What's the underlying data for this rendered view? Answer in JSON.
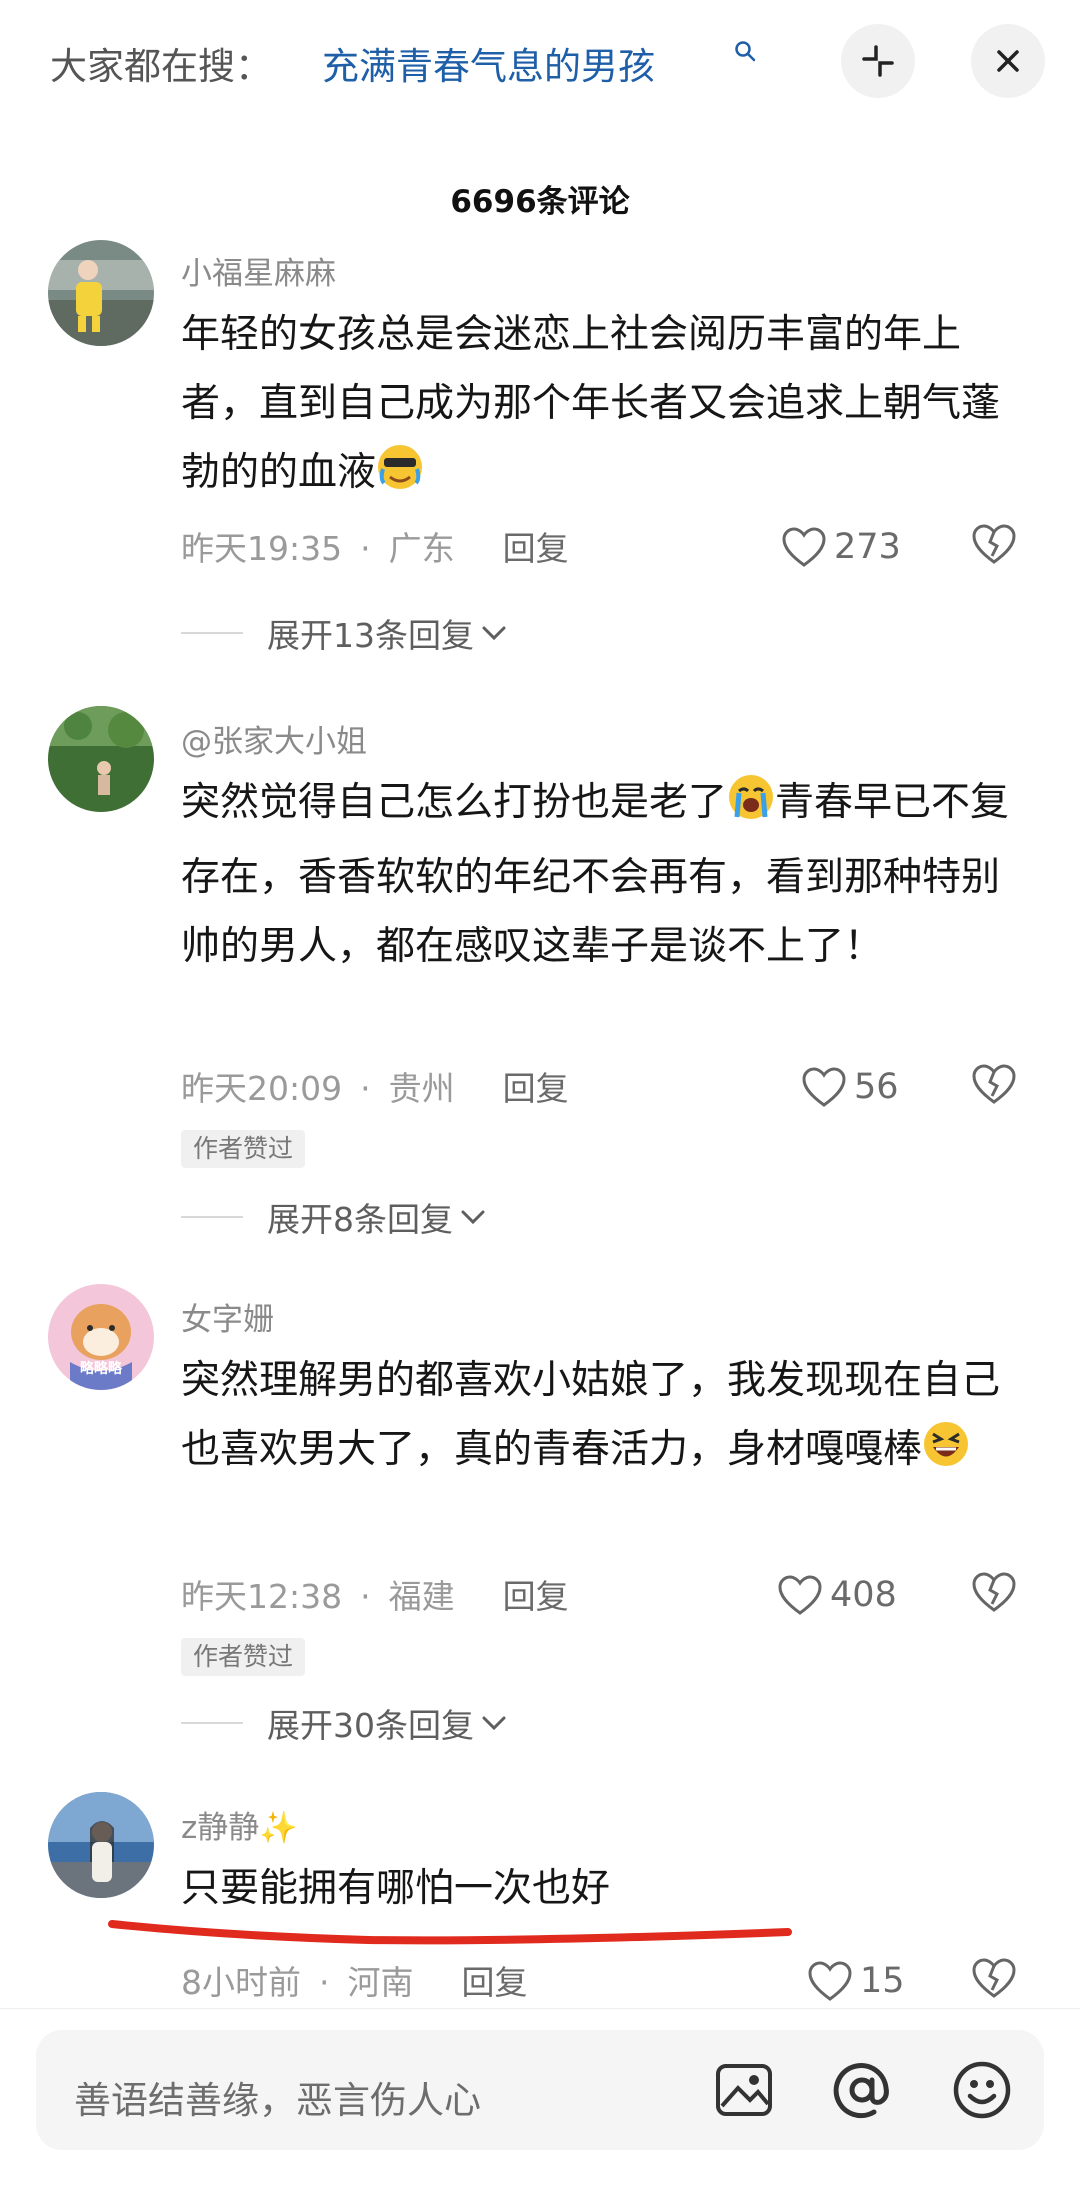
{
  "search_bar": {
    "prefix": "大家都在搜：",
    "term": "充满青春气息的男孩"
  },
  "comments_header": {
    "count_label": "6696条评论"
  },
  "comments": [
    {
      "username": "小福星麻麻",
      "text": "年轻的女孩总是会迷恋上社会阅历丰富的年上者，直到自己成为那个年长者又会追求上朝气蓬勃的的血液",
      "emoji": "crying-sunglasses-face-icon",
      "time": "昨天19:35",
      "location": "广东",
      "reply_label": "回复",
      "likes": "273",
      "badge": "",
      "expand_label": "展开13条回复"
    },
    {
      "username": "@张家大小姐",
      "text_part1": "突然觉得自己怎么打扮也是老了",
      "text_part2": "青春早已不复存在，香香软软的年纪不会再有，看到那种特别帅的男人，都在感叹这辈子是谈不上了！",
      "emoji": "crying-face-icon",
      "time": "昨天20:09",
      "location": "贵州",
      "reply_label": "回复",
      "likes": "56",
      "badge": "作者赞过",
      "expand_label": "展开8条回复"
    },
    {
      "username": "女字姗",
      "text": "突然理解男的都喜欢小姑娘了，我发现现在自己也喜欢男大了，真的青春活力，身材嘎嘎棒",
      "emoji": "laughing-face-icon",
      "avatar_label": "略略略",
      "time": "昨天12:38",
      "location": "福建",
      "reply_label": "回复",
      "likes": "408",
      "badge": "作者赞过",
      "expand_label": "展开30条回复"
    },
    {
      "username": "z静静✨",
      "text": "只要能拥有哪怕一次也好",
      "time": "8小时前",
      "location": "河南",
      "reply_label": "回复",
      "likes": "15"
    }
  ],
  "input": {
    "placeholder": "善语结善缘，恶言伤人心"
  },
  "colors": {
    "accent_blue": "#1f5fa8",
    "underline_red": "#e02a1d",
    "emoji_yellow": "#f7c531"
  }
}
